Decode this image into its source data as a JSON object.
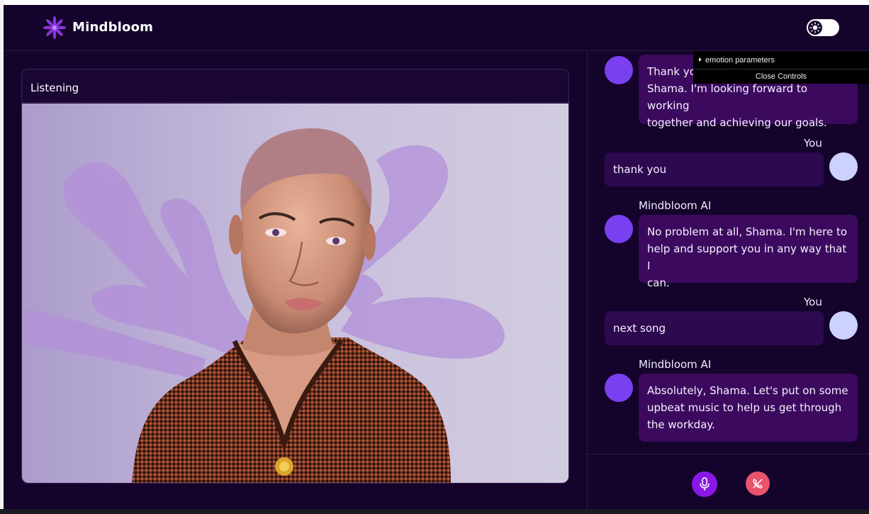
{
  "app": {
    "brand": "Mindbloom",
    "accent": "#7b3ff2",
    "background": "#14032a"
  },
  "avatar_panel": {
    "status": "Listening"
  },
  "chat": {
    "messages": [
      {
        "role": "ai",
        "sender": "",
        "text_lines": [
          "Thank you",
          "Shama. I'm looking forward to working",
          "together and achieving our goals."
        ]
      },
      {
        "role": "user",
        "sender": "You",
        "text_lines": [
          "thank you"
        ]
      },
      {
        "role": "ai",
        "sender": "Mindbloom AI",
        "text_lines": [
          "No problem at all, Shama. I'm here to",
          "help and support you in any way that I",
          "can."
        ]
      },
      {
        "role": "user",
        "sender": "You",
        "text_lines": [
          "next song"
        ]
      },
      {
        "role": "ai",
        "sender": "Mindbloom AI",
        "text_lines": [
          "Absolutely, Shama. Let's put on some",
          "upbeat music to help us get through",
          "the workday."
        ]
      }
    ]
  },
  "controls": {
    "mic_color": "#8a17e8",
    "end_call_color": "#e8546c"
  },
  "gui_overlay": {
    "folder_label": "emotion parameters",
    "close_label": "Close Controls"
  },
  "icons": {
    "logo": "flower-logo-icon",
    "theme": "sun-icon",
    "mic": "microphone-icon",
    "end_call": "phone-hangup-icon"
  }
}
